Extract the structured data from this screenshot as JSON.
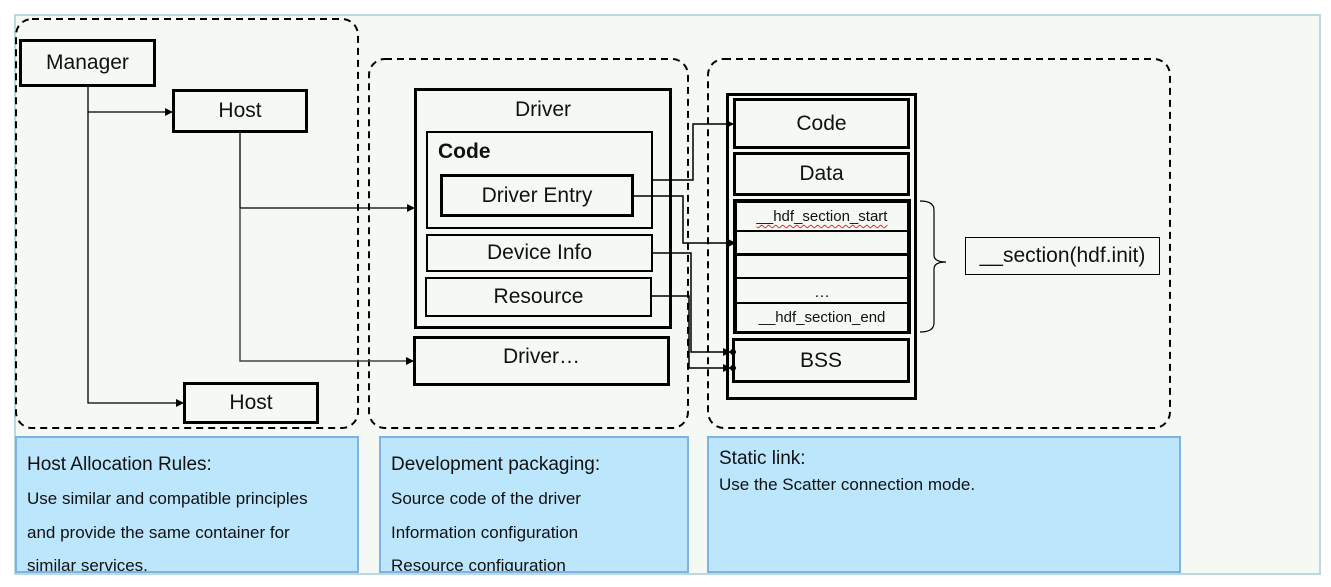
{
  "left_group": {
    "manager": "Manager",
    "host_top": "Host",
    "host_bottom": "Host"
  },
  "middle_group": {
    "driver_title": "Driver",
    "code_label": "Code",
    "driver_entry": "Driver Entry",
    "device_info": "Device Info",
    "resource": "Resource",
    "driver_more": "Driver…"
  },
  "right_group": {
    "code": "Code",
    "data": "Data",
    "section_start": "__hdf_section_start",
    "ellipsis": "…",
    "section_end": "__hdf_section_end",
    "bss": "BSS",
    "section_annotation": "__section(hdf.init)"
  },
  "panels": [
    {
      "title": "Host Allocation Rules:",
      "lines": [
        "Use similar and compatible principles",
        "and provide the same container for",
        "similar services."
      ]
    },
    {
      "title": "Development packaging:",
      "lines": [
        "Source code of the driver",
        "Information configuration",
        "Resource configuration"
      ]
    },
    {
      "title": "Static link:",
      "lines": [
        "Use the Scatter connection mode."
      ]
    }
  ]
}
